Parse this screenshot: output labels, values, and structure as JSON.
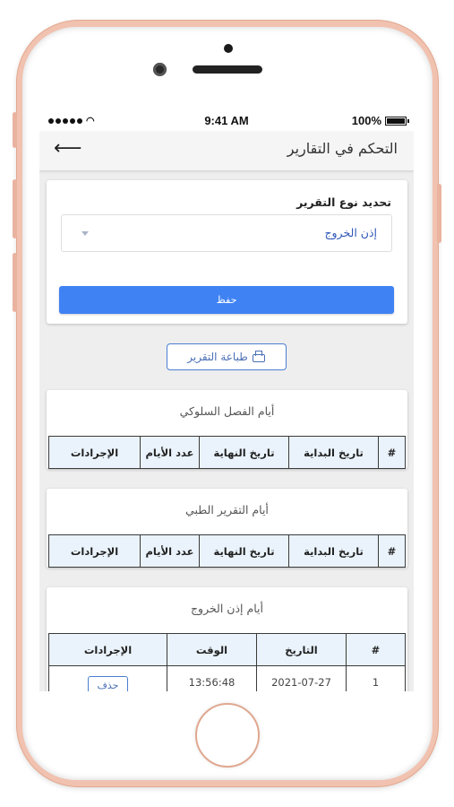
{
  "status_bar": {
    "time": "9:41 AM",
    "battery": "100%"
  },
  "app_bar": {
    "title": "التحكم في التقارير"
  },
  "form": {
    "label": "تحديد نوع التقرير",
    "selected_value": "إذن الخروج",
    "save_label": "حفظ"
  },
  "print_label": "طباعة التقرير",
  "sections": [
    {
      "title": "أيام الفصل السلوكي",
      "headers": [
        "#",
        "تاريخ البداية",
        "تاريخ النهاية",
        "عدد الأيام",
        "الإجرادات"
      ]
    },
    {
      "title": "أيام التقرير الطبي",
      "headers": [
        "#",
        "تاريخ البداية",
        "تاريخ النهاية",
        "عدد الأيام",
        "الإجرادات"
      ]
    },
    {
      "title": "أيام إذن الخروج",
      "headers": [
        "#",
        "التاريخ",
        "الوقت",
        "الإجرادات"
      ],
      "rows": [
        {
          "index": "1",
          "date": "2021-07-27",
          "time": "13:56:48",
          "action": "حذف"
        }
      ]
    }
  ]
}
